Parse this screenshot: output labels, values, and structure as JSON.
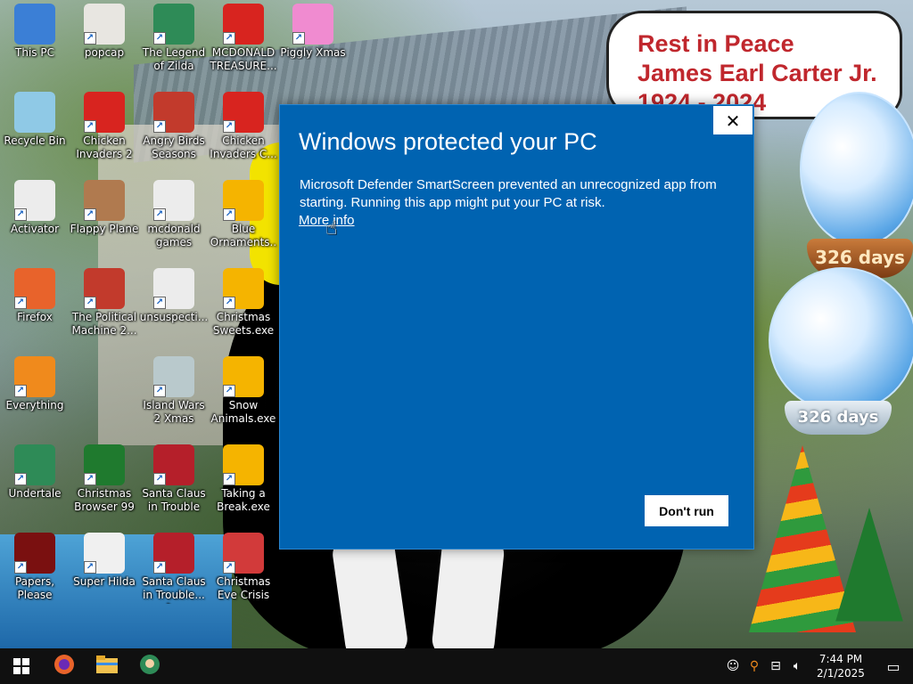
{
  "desktop": {
    "wallpaper_text": {
      "memorial_line1": "Rest in Peace",
      "memorial_line2": "James Earl Carter Jr.",
      "memorial_line3": "1924 - 2024",
      "globe1_days": "326 days",
      "globe2_days": "326 days"
    },
    "icons": [
      {
        "label": "This PC",
        "icon": "computer-icon",
        "color": "#3b7fd6"
      },
      {
        "label": "popcap",
        "icon": "folder-icon",
        "color": "#e8e6e1"
      },
      {
        "label": "The Legend of Zilda",
        "icon": "game-character-icon",
        "color": "#2e8b57"
      },
      {
        "label": "MCDONALD TREASURE...",
        "icon": "mcdonalds-icon",
        "color": "#d8241f"
      },
      {
        "label": "Piggly Xmas",
        "icon": "pig-icon",
        "color": "#f08bd0"
      },
      {
        "label": "Recycle Bin",
        "icon": "recycle-bin-icon",
        "color": "#8fc9e6"
      },
      {
        "label": "Chicken Invaders 2",
        "icon": "chicken-icon",
        "color": "#d8241f"
      },
      {
        "label": "Angry Birds Seasons",
        "icon": "angry-bird-icon",
        "color": "#c23a2c"
      },
      {
        "label": "Chicken Invaders C...",
        "icon": "chicken-santa-icon",
        "color": "#d8241f"
      },
      {
        "label": "Activator",
        "icon": "file-icon",
        "color": "#ececec"
      },
      {
        "label": "Flappy Plane",
        "icon": "flappy-plane-icon",
        "color": "#b07a4f"
      },
      {
        "label": "mcdonald games",
        "icon": "folder-icon",
        "color": "#ececec"
      },
      {
        "label": "Blue Ornaments....",
        "icon": "gift-icon",
        "color": "#f5b400"
      },
      {
        "label": "Firefox",
        "icon": "firefox-icon",
        "color": "#e8632b"
      },
      {
        "label": "The Political Machine 2...",
        "icon": "political-machine-icon",
        "color": "#c23a2c"
      },
      {
        "label": "unsuspecti...",
        "icon": "file-icon",
        "color": "#ececec"
      },
      {
        "label": "Christmas Sweets.exe",
        "icon": "gift-icon",
        "color": "#f5b400"
      },
      {
        "label": "Everything",
        "icon": "search-icon",
        "color": "#f08a1c"
      },
      {
        "label": "Island Wars 2 Xmas",
        "icon": "island-wars-icon",
        "color": "#b9c9cc"
      },
      {
        "label": "Snow Animals.exe",
        "icon": "gift-icon",
        "color": "#f5b400"
      },
      {
        "label": "Undertale",
        "icon": "undertale-icon",
        "color": "#2e8b57"
      },
      {
        "label": "Christmas Browser 99",
        "icon": "christmas-tree-icon",
        "color": "#1f7a2e"
      },
      {
        "label": "Santa Claus in Trouble",
        "icon": "santa-icon",
        "color": "#b51f2a"
      },
      {
        "label": "Taking a Break.exe",
        "icon": "gift-icon",
        "color": "#f5b400"
      },
      {
        "label": "Papers, Please",
        "icon": "papers-please-icon",
        "color": "#7a1010"
      },
      {
        "label": "Super Hilda",
        "icon": "super-hilda-icon",
        "color": "#f0f0f0"
      },
      {
        "label": "Santa Claus in Trouble... A...",
        "icon": "santa-icon",
        "color": "#b51f2a"
      },
      {
        "label": "Christmas Eve Crisis",
        "icon": "santa-face-icon",
        "color": "#d23a3a"
      }
    ]
  },
  "dialog": {
    "title": "Windows protected your PC",
    "message": "Microsoft Defender SmartScreen prevented an unrecognized app from starting. Running this app might put your PC at risk.",
    "more_info": "More info",
    "dont_run": "Don't run",
    "close_glyph": "✕",
    "background_color": "#0063b1"
  },
  "taskbar": {
    "pinned": [
      {
        "name": "start-button",
        "icon": "windows-logo-icon"
      },
      {
        "name": "firefox-taskbar-button",
        "icon": "firefox-icon"
      },
      {
        "name": "file-explorer-taskbar-button",
        "icon": "folder-icon"
      },
      {
        "name": "zilda-taskbar-button",
        "icon": "game-character-icon"
      }
    ],
    "tray": {
      "time": "7:44 PM",
      "date": "2/1/2025"
    }
  }
}
